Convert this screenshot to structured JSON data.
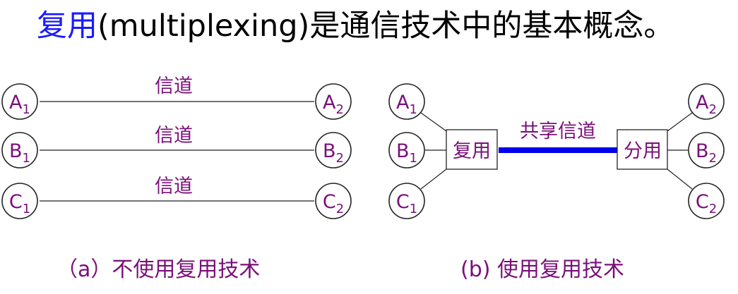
{
  "title": {
    "highlight": "复用",
    "rest": "(multiplexing)是通信技术中的基本概念。"
  },
  "colors": {
    "highlight": "#1a1aff",
    "label": "#7a0f7a",
    "shared_channel": "#0000ee"
  },
  "diagram_a": {
    "channel_label": "信道",
    "nodes_left": [
      {
        "letter": "A",
        "sub": "1"
      },
      {
        "letter": "B",
        "sub": "1"
      },
      {
        "letter": "C",
        "sub": "1"
      }
    ],
    "nodes_right": [
      {
        "letter": "A",
        "sub": "2"
      },
      {
        "letter": "B",
        "sub": "2"
      },
      {
        "letter": "C",
        "sub": "2"
      }
    ],
    "caption": "（a）不使用复用技术"
  },
  "diagram_b": {
    "mux_label": "复用",
    "demux_label": "分用",
    "shared_label": "共享信道",
    "nodes_left": [
      {
        "letter": "A",
        "sub": "1"
      },
      {
        "letter": "B",
        "sub": "1"
      },
      {
        "letter": "C",
        "sub": "1"
      }
    ],
    "nodes_right": [
      {
        "letter": "A",
        "sub": "2"
      },
      {
        "letter": "B",
        "sub": "2"
      },
      {
        "letter": "C",
        "sub": "2"
      }
    ],
    "caption": "(b) 使用复用技术"
  }
}
